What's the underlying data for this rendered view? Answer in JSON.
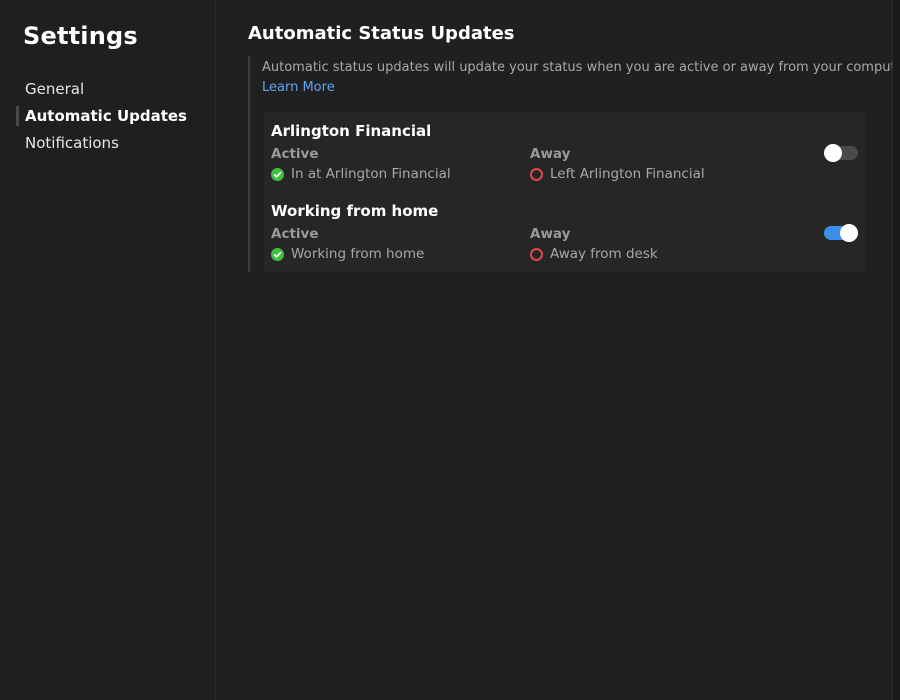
{
  "sidebar": {
    "title": "Settings",
    "items": [
      {
        "label": "General",
        "active": false
      },
      {
        "label": "Automatic Updates",
        "active": true
      },
      {
        "label": "Notifications",
        "active": false
      }
    ]
  },
  "main": {
    "title": "Automatic Status Updates",
    "description": "Automatic status updates will update your status when you are active or away from your computer.",
    "learn_more": "Learn More",
    "cards": [
      {
        "name": "Arlington Financial",
        "active_label": "Active",
        "active_status": "In at Arlington Financial",
        "away_label": "Away",
        "away_status": "Left Arlington Financial",
        "enabled": false
      },
      {
        "name": "Working from home",
        "active_label": "Active",
        "active_status": "Working from home",
        "away_label": "Away",
        "away_status": "Away from desk",
        "enabled": true
      }
    ]
  },
  "colors": {
    "accent": "#3b8fe8",
    "link": "#5aa4f5",
    "active_status": "#3fbf3f",
    "away_status": "#e0484b"
  }
}
